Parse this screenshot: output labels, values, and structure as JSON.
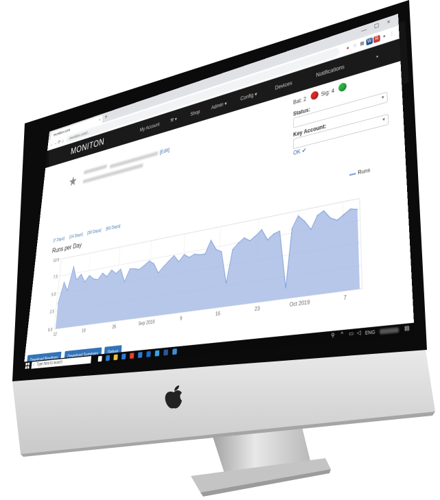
{
  "browser": {
    "tab_title": "moniton.com",
    "tab_close": "×",
    "new_tab": "+",
    "window_controls": [
      "—",
      "☐",
      "×"
    ],
    "nav_icons": [
      "←",
      "→",
      "⟳",
      "⌂"
    ],
    "address": "moniton.com/...",
    "extensions": [
      {
        "icon": "adblock-icon",
        "color": "#c4302b",
        "glyph": "●"
      },
      {
        "icon": "star-icon",
        "color": "#777777",
        "glyph": "☆"
      },
      {
        "icon": "grid-icon",
        "color": "#555555",
        "glyph": "▦"
      },
      {
        "icon": "w-icon",
        "color": "#1a4d8f",
        "glyph": "W"
      },
      {
        "icon": "r-icon",
        "color": "#c4302b",
        "glyph": "R"
      },
      {
        "icon": "profile-icon",
        "color": "#777777",
        "glyph": "●"
      },
      {
        "icon": "menu-icon",
        "color": "#555555",
        "glyph": "⋮"
      }
    ]
  },
  "app": {
    "brand": "MONITON",
    "nav": [
      {
        "name": "my-account",
        "label": "My Account"
      },
      {
        "name": "tools",
        "label": "⚒ ▾"
      },
      {
        "name": "shop",
        "label": "Shop"
      },
      {
        "name": "admin",
        "label": "Admin ▾"
      },
      {
        "name": "config",
        "label": "Config ▾"
      },
      {
        "name": "devices",
        "label": "Devices"
      },
      {
        "name": "notifications",
        "label": "Notifications"
      },
      {
        "name": "more",
        "label": "▪"
      }
    ]
  },
  "device": {
    "edit_label": "[Edit]",
    "bat_label": "Bat: 2",
    "sig_label": "Sig: 4",
    "bat_color": "#e02020",
    "sig_color": "#22b03a",
    "status_label": "Status:",
    "key_account_label": "Key Account:",
    "ok_label": "OK ✔"
  },
  "chart_controls": {
    "ranges": [
      "[7 Days]",
      "[14 Days]",
      "[30 Days]",
      "[60 Days]"
    ],
    "legend": "Runs"
  },
  "chart_data": {
    "type": "area",
    "title": "Runs per Day",
    "xlabel": "",
    "ylabel": "",
    "ylim": [
      0,
      10
    ],
    "y_ticks": [
      "0.0",
      "2.5",
      "5.0",
      "7.5",
      "10.0"
    ],
    "x_ticks": [
      "12",
      "19",
      "26",
      "Sep 2019",
      "9",
      "16",
      "23",
      "Oct 2019",
      "7"
    ],
    "grid": true,
    "legend": "top-right",
    "series": [
      {
        "name": "Runs",
        "color": "#7f9fd6",
        "fill": "#a9bde6",
        "values": [
          3.5,
          6.5,
          5.2,
          8.5,
          6.5,
          7.2,
          6.0,
          6.8,
          6.2,
          6.0,
          6.8,
          6.2,
          7.0,
          6.4,
          6.9,
          5.1,
          6.7,
          6.6,
          6.4,
          6.8,
          7.3,
          6.8,
          5.5,
          6.2,
          6.8,
          7.4,
          6.5,
          7.3,
          6.8,
          7.1,
          6.9,
          6.9,
          8.5,
          7.2,
          6.8,
          2.8,
          6.8,
          7.5,
          8.0,
          7.5,
          8.0,
          8.6,
          7.2,
          7.8,
          8.0,
          1.2,
          8.0,
          9.4,
          8.6,
          7.5,
          9.0,
          9.4,
          8.4,
          8.0,
          8.5,
          9.0,
          8.8
        ]
      }
    ]
  },
  "actions": {
    "download_readings": "Download Readings",
    "download_summary": "Download Summary",
    "debug": "Debug"
  },
  "taskbar": {
    "search_placeholder": "Type here to search",
    "lang": "ENG",
    "apps": [
      {
        "icon": "task-view-icon",
        "color": "#ffffff"
      },
      {
        "icon": "edge-icon",
        "color": "#2b7bd6"
      },
      {
        "icon": "explorer-icon",
        "color": "#e8c046"
      },
      {
        "icon": "store-icon",
        "color": "#2b7bd6"
      },
      {
        "icon": "chrome-icon",
        "color": "#e34133"
      },
      {
        "icon": "mail-icon",
        "color": "#2b7bd6"
      },
      {
        "icon": "outlook-icon",
        "color": "#1b6ac4"
      },
      {
        "icon": "ie-icon",
        "color": "#3aa0e8"
      },
      {
        "icon": "word-icon",
        "color": "#2b5797"
      },
      {
        "icon": "app-icon",
        "color": "#3b8fd6"
      }
    ]
  }
}
